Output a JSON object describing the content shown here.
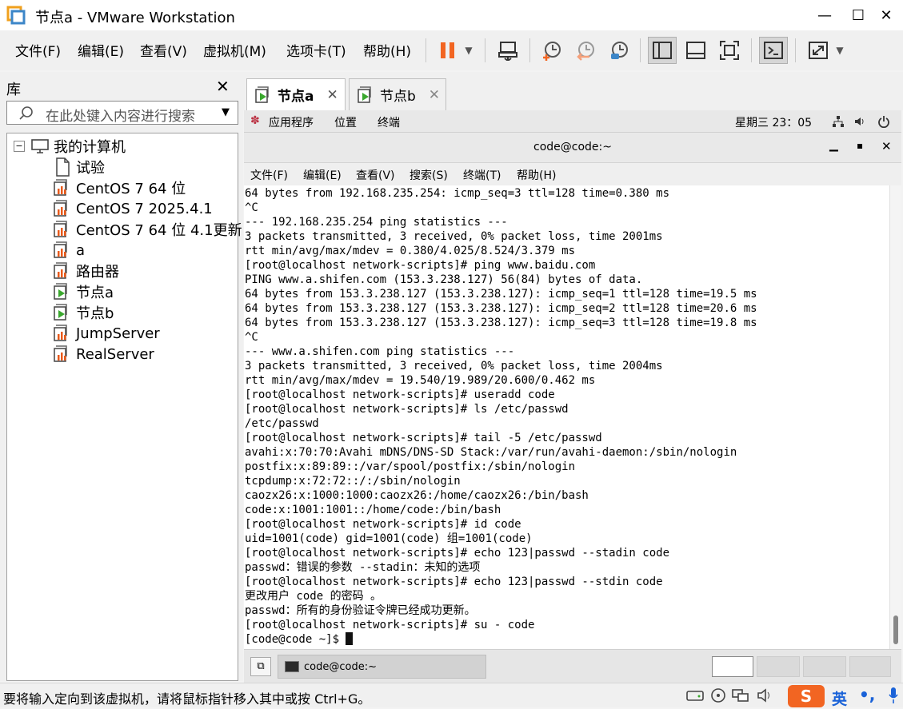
{
  "window": {
    "title": "节点a - VMware Workstation"
  },
  "menubar": {
    "items": [
      "文件(F)",
      "编辑(E)",
      "查看(V)",
      "虚拟机(M)",
      "选项卡(T)",
      "帮助(H)"
    ]
  },
  "library": {
    "title": "库",
    "search_placeholder": "在此处键入内容进行搜索",
    "root": "我的计算机",
    "items": [
      {
        "label": "试验",
        "kind": "doc"
      },
      {
        "label": "CentOS 7 64 位",
        "kind": "vm-off"
      },
      {
        "label": "CentOS 7 2025.4.1",
        "kind": "vm-off"
      },
      {
        "label": "CentOS 7 64 位 4.1更新",
        "kind": "vm-off"
      },
      {
        "label": "a",
        "kind": "vm-off"
      },
      {
        "label": "路由器",
        "kind": "vm-off"
      },
      {
        "label": "节点a",
        "kind": "vm-on"
      },
      {
        "label": "节点b",
        "kind": "vm-on"
      },
      {
        "label": "JumpServer",
        "kind": "vm-off"
      },
      {
        "label": "RealServer",
        "kind": "vm-off"
      }
    ]
  },
  "tabs": [
    {
      "label": "节点a",
      "active": true
    },
    {
      "label": "节点b",
      "active": false
    }
  ],
  "gnome": {
    "menus": [
      "应用程序",
      "位置",
      "终端"
    ],
    "clock": "星期三 23：05"
  },
  "terminal": {
    "title": "code@code:~",
    "menu": [
      "文件(F)",
      "编辑(E)",
      "查看(V)",
      "搜索(S)",
      "终端(T)",
      "帮助(H)"
    ],
    "lines": [
      "64 bytes from 192.168.235.254: icmp_seq=3 ttl=128 time=0.380 ms",
      "^C",
      "--- 192.168.235.254 ping statistics ---",
      "3 packets transmitted, 3 received, 0% packet loss, time 2001ms",
      "rtt min/avg/max/mdev = 0.380/4.025/8.524/3.379 ms",
      "[root@localhost network-scripts]# ping www.baidu.com",
      "PING www.a.shifen.com (153.3.238.127) 56(84) bytes of data.",
      "64 bytes from 153.3.238.127 (153.3.238.127): icmp_seq=1 ttl=128 time=19.5 ms",
      "64 bytes from 153.3.238.127 (153.3.238.127): icmp_seq=2 ttl=128 time=20.6 ms",
      "64 bytes from 153.3.238.127 (153.3.238.127): icmp_seq=3 ttl=128 time=19.8 ms",
      "^C",
      "--- www.a.shifen.com ping statistics ---",
      "3 packets transmitted, 3 received, 0% packet loss, time 2004ms",
      "rtt min/avg/max/mdev = 19.540/19.989/20.600/0.462 ms",
      "[root@localhost network-scripts]# useradd code",
      "[root@localhost network-scripts]# ls /etc/passwd",
      "/etc/passwd",
      "[root@localhost network-scripts]# tail -5 /etc/passwd",
      "avahi:x:70:70:Avahi mDNS/DNS-SD Stack:/var/run/avahi-daemon:/sbin/nologin",
      "postfix:x:89:89::/var/spool/postfix:/sbin/nologin",
      "tcpdump:x:72:72::/:/sbin/nologin",
      "caozx26:x:1000:1000:caozx26:/home/caozx26:/bin/bash",
      "code:x:1001:1001::/home/code:/bin/bash",
      "[root@localhost network-scripts]# id code",
      "uid=1001(code) gid=1001(code) 组=1001(code)",
      "[root@localhost network-scripts]# echo 123|passwd --stadin code",
      "passwd：错误的参数 --stadin：未知的选项",
      "[root@localhost network-scripts]# echo 123|passwd --stdin code",
      "更改用户 code 的密码 。",
      "passwd：所有的身份验证令牌已经成功更新。",
      "[root@localhost network-scripts]# su - code"
    ],
    "prompt": "[code@code ~]$ "
  },
  "taskbar": {
    "item": "code@code:~"
  },
  "status": {
    "text": "要将输入定向到该虚拟机，请将鼠标指针移入其中或按 Ctrl+G。",
    "ime": "英"
  },
  "colors": {
    "accent_orange": "#f26522",
    "vm_green": "#3aa82e",
    "logo_red": "#e85a1b"
  }
}
